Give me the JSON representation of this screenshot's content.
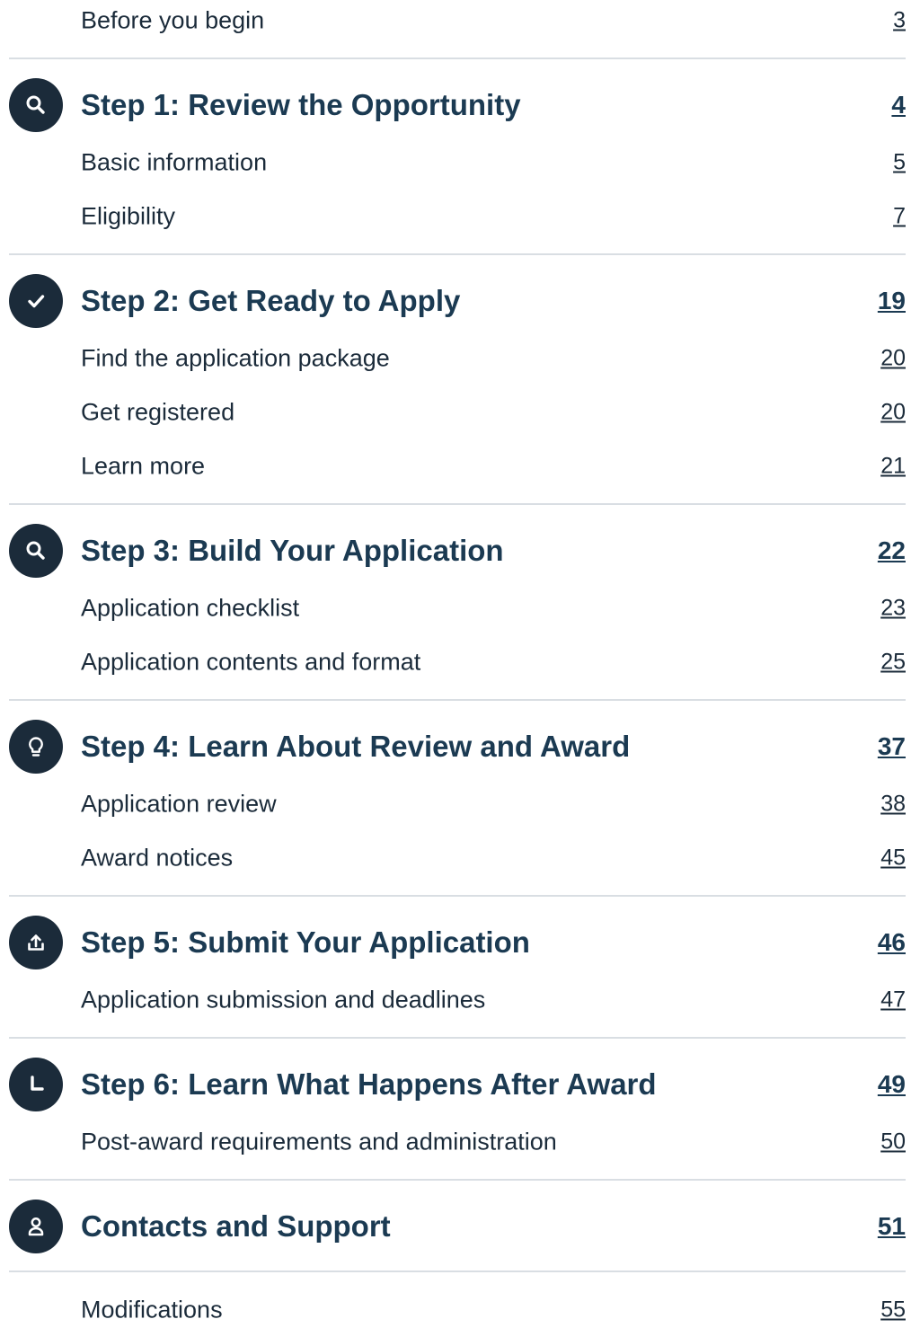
{
  "toc": {
    "before": {
      "label": "Before you begin",
      "page": "3"
    },
    "step1": {
      "title": "Step 1: Review the Opportunity",
      "page": "4",
      "icon": "search-icon",
      "items": [
        {
          "label": "Basic information",
          "page": "5"
        },
        {
          "label": "Eligibility",
          "page": "7"
        }
      ]
    },
    "step2": {
      "title": "Step 2: Get Ready to Apply",
      "page": "19",
      "icon": "checkmark-icon",
      "items": [
        {
          "label": "Find the application package",
          "page": "20"
        },
        {
          "label": "Get registered",
          "page": "20"
        },
        {
          "label": "Learn more",
          "page": "21"
        }
      ]
    },
    "step3": {
      "title": "Step 3: Build Your Application",
      "page": "22",
      "icon": "search-icon",
      "items": [
        {
          "label": "Application checklist",
          "page": "23"
        },
        {
          "label": "Application contents and format",
          "page": "25"
        }
      ]
    },
    "step4": {
      "title": "Step 4: Learn About Review and Award",
      "page": "37",
      "icon": "lightbulb-icon",
      "items": [
        {
          "label": "Application review",
          "page": "38"
        },
        {
          "label": "Award notices",
          "page": "45"
        }
      ]
    },
    "step5": {
      "title": "Step 5: Submit Your Application",
      "page": "46",
      "icon": "upload-icon",
      "items": [
        {
          "label": "Application submission and deadlines",
          "page": "47"
        }
      ]
    },
    "step6": {
      "title": "Step 6: Learn What Happens After Award",
      "page": "49",
      "icon": "clock-icon",
      "items": [
        {
          "label": "Post-award requirements and administration",
          "page": "50"
        }
      ]
    },
    "contacts": {
      "title": "Contacts and Support",
      "page": "51",
      "icon": "person-icon"
    },
    "modifications": {
      "label": "Modifications",
      "page": "55"
    }
  }
}
